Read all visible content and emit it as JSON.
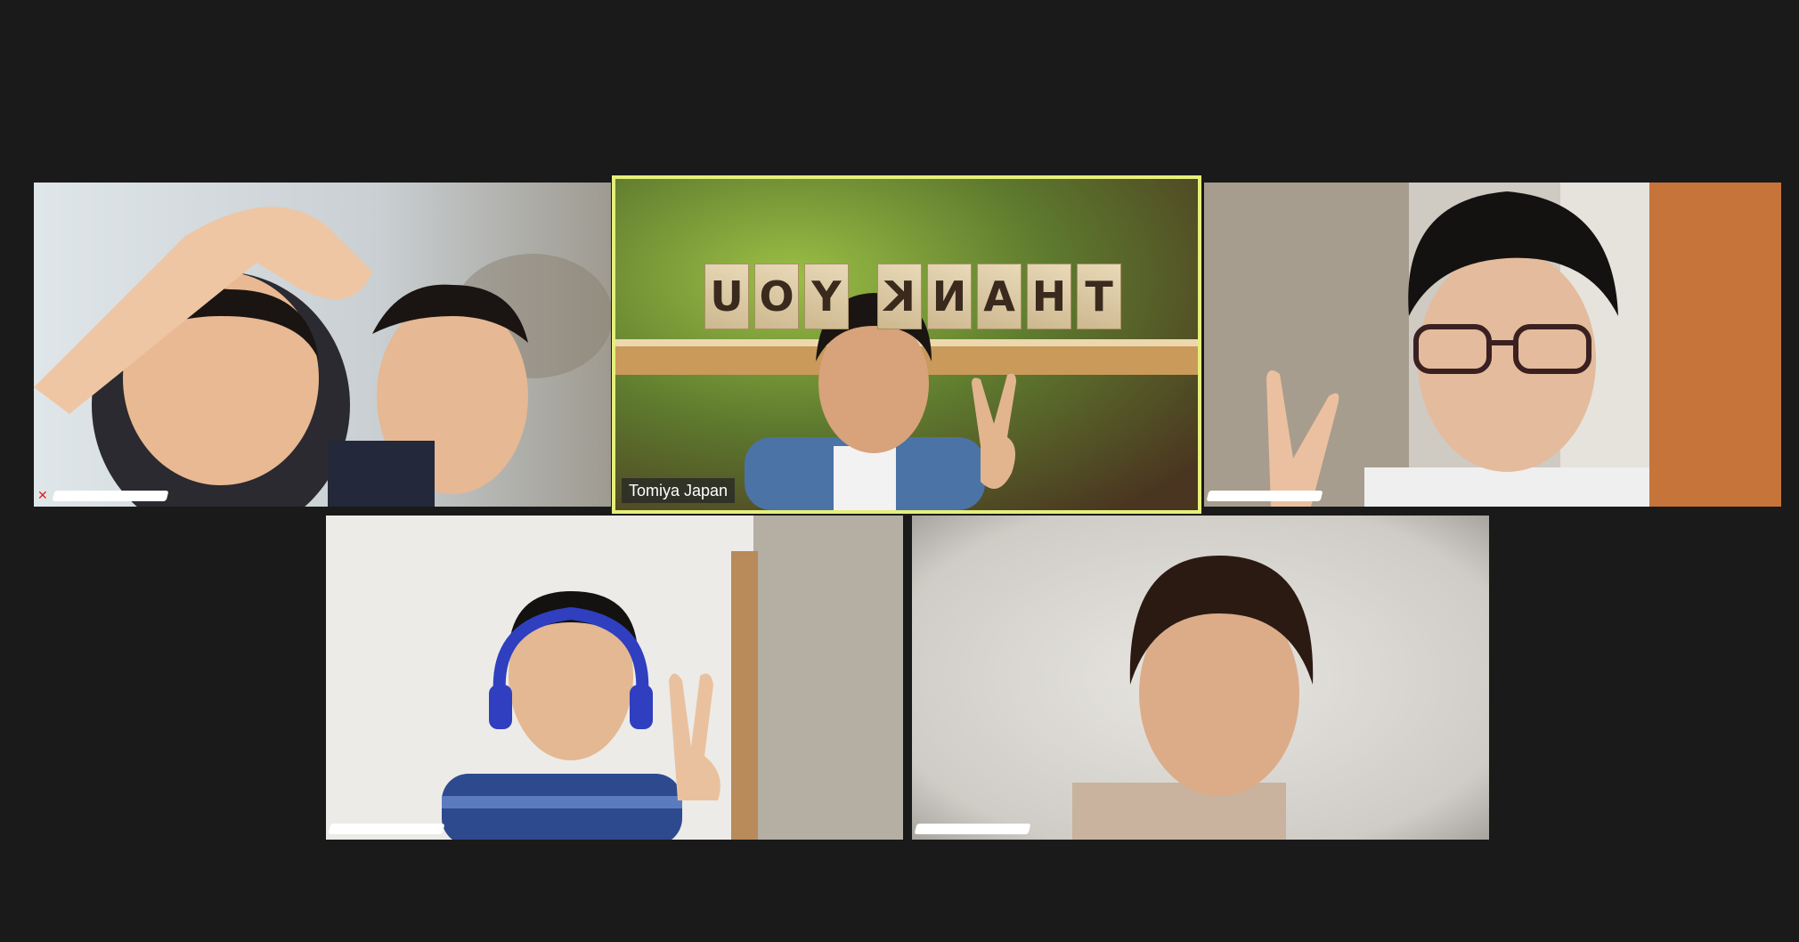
{
  "meeting": {
    "view": "gallery",
    "participants": [
      {
        "id": "p1",
        "name": "",
        "name_redacted": true,
        "muted": true,
        "active_speaker": false
      },
      {
        "id": "p2",
        "name": "Tomiya Japan",
        "name_redacted": false,
        "muted": false,
        "active_speaker": true,
        "virtual_background_text": "THANK YOU"
      },
      {
        "id": "p3",
        "name": "",
        "name_redacted": true,
        "muted": false,
        "active_speaker": false
      },
      {
        "id": "p4",
        "name": "",
        "name_redacted": true,
        "muted": false,
        "active_speaker": false
      },
      {
        "id": "p5",
        "name": "",
        "name_redacted": true,
        "muted": false,
        "active_speaker": false
      }
    ]
  },
  "colors": {
    "background": "#1a1a1a",
    "active_speaker_border": "#e6ef7a",
    "muted_icon": "#e02020"
  },
  "icons": {
    "muted": "mic-muted-icon"
  }
}
